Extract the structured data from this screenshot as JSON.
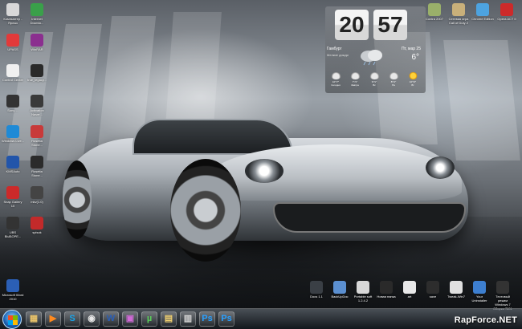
{
  "desktop_left_icons": [
    {
      "label": "Компьютер - Ярлык",
      "name": "computer-shortcut",
      "color": "#d8d8d8"
    },
    {
      "label": "Internet Downlo...",
      "name": "internet-download-manager",
      "color": "#3aa04a"
    },
    {
      "label": "UPASS",
      "name": "upass",
      "color": "#e23a3a"
    },
    {
      "label": "WinRAR",
      "name": "winrar",
      "color": "#8b2f8f"
    },
    {
      "label": "Control Center",
      "name": "control-center",
      "color": "#f0f0f0"
    },
    {
      "label": "true_legacy...",
      "name": "true-legacy",
      "color": "#2a2a2a"
    },
    {
      "label": "Sony ...",
      "name": "sony-shortcut",
      "color": "#333333"
    },
    {
      "label": "Activation Naver...",
      "name": "activation-naver",
      "color": "#3a3a3a"
    },
    {
      "label": "Windows Live...",
      "name": "windows-live",
      "color": "#1f8ad6"
    },
    {
      "label": "Rosetta Stone...",
      "name": "rosetta-stone",
      "color": "#c83a3a"
    },
    {
      "label": "KMSAuto",
      "name": "kmsauto",
      "color": "#2255aa"
    },
    {
      "label": "Rosetta Stone...",
      "name": "rosetta-stone-2",
      "color": "#2b2b2b"
    },
    {
      "label": "Snap Gallery 10",
      "name": "snap-gallery",
      "color": "#cc2a2a"
    },
    {
      "label": "mkv(1.0)",
      "name": "mkv",
      "color": "#444444"
    },
    {
      "label": "UBS ВЫБОРЕ...",
      "name": "ubs",
      "color": "#333333"
    },
    {
      "label": "spisok",
      "name": "spisok",
      "color": "#c22a2a"
    },
    {
      "label": "Microsoft Word 2010",
      "name": "microsoft-word-2010",
      "color": "#2b5fb6"
    }
  ],
  "desktop_top_right_icons": [
    {
      "label": "Contra 2007",
      "name": "contra-2007",
      "color": "#9ab06a"
    },
    {
      "label": "Сетевая игра Call of Duty 2",
      "name": "call-of-duty-2",
      "color": "#c9b07a"
    },
    {
      "label": "Chrome Edition",
      "name": "chrome",
      "color": "#4da3e0"
    },
    {
      "label": "Opera ACT II",
      "name": "opera-act",
      "color": "#cc2a2a"
    }
  ],
  "desktop_bottom_icons": [
    {
      "label": "Docs 1.1",
      "name": "docs",
      "color": "#3a3f45"
    },
    {
      "label": "BackUpDoc",
      "name": "backupdoc",
      "color": "#5b8fd0"
    },
    {
      "label": "Portable soft 1.2.4.2",
      "name": "portable-soft",
      "color": "#d8d8d8"
    },
    {
      "label": "Новая папка",
      "name": "new-folder",
      "color": "#2a2a2a"
    },
    {
      "label": "art",
      "name": "art",
      "color": "#e8e8e8"
    },
    {
      "label": "save",
      "name": "save",
      "color": "#2d2d2d"
    },
    {
      "label": "Tweak-Win7",
      "name": "tweak-win7",
      "color": "#e0e0e0"
    },
    {
      "label": "Your Uninstaller",
      "name": "your-uninstaller",
      "color": "#3d7fd0"
    },
    {
      "label": "Тестовый режим Windows 7 Сборка 7601",
      "name": "test-mode-info",
      "color": "#333333"
    }
  ],
  "clock": {
    "hours": "20",
    "minutes": "57"
  },
  "weather": {
    "city": "Гамбург",
    "date": "Пт, мар 25",
    "condition": "Мелкие дожди",
    "temperature": "6°",
    "forecast": [
      {
        "temp": "10°/7°",
        "day": "Сегодня",
        "icon": "cloud"
      },
      {
        "temp": "7°/1°",
        "day": "Завтра",
        "icon": "cloud"
      },
      {
        "temp": "9°/1°",
        "day": "Вс",
        "icon": "cloud"
      },
      {
        "temp": "8°/1°",
        "day": "Пн",
        "icon": "cloud"
      },
      {
        "temp": "10°/3°",
        "day": "Вт",
        "icon": "sun"
      }
    ]
  },
  "taskbar": {
    "start_label": "Start",
    "buttons": [
      {
        "name": "explorer",
        "glyph": "▦",
        "color": "#e8c26a"
      },
      {
        "name": "media-player",
        "glyph": "▶",
        "color": "#ff8a1e"
      },
      {
        "name": "skype",
        "glyph": "S",
        "color": "#1aa3e8"
      },
      {
        "name": "chrome",
        "glyph": "◉",
        "color": "#e8e8e8"
      },
      {
        "name": "word",
        "glyph": "W",
        "color": "#2b5fb6"
      },
      {
        "name": "winrar",
        "glyph": "▣",
        "color": "#d06ad6"
      },
      {
        "name": "utorrent",
        "glyph": "µ",
        "color": "#5bd05b"
      },
      {
        "name": "folder",
        "glyph": "▤",
        "color": "#f0d070"
      },
      {
        "name": "media",
        "glyph": "▥",
        "color": "#d8d8d8"
      },
      {
        "name": "photoshop",
        "glyph": "Ps",
        "color": "#2aa0ff"
      },
      {
        "name": "photoshop-2",
        "glyph": "Ps",
        "color": "#2aa0ff"
      }
    ]
  },
  "watermark": "RapForce.NET"
}
